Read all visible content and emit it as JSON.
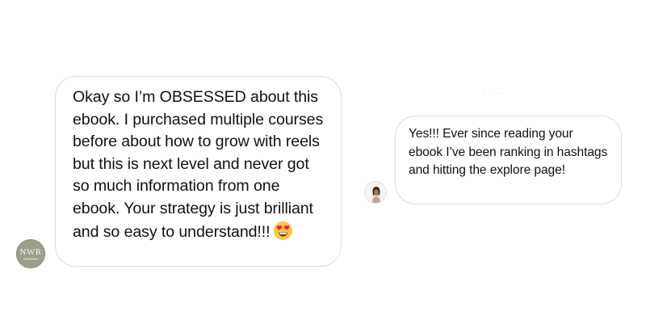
{
  "conversation": {
    "left_message": {
      "text": "Okay so I’m OBSESSED about this ebook. I purchased multiple courses before about how to grow with reels but this is next level and never got so much information from one ebook. Your strategy is just brilliant and so easy to understand!!!",
      "emoji": "heart-eyes-emoji",
      "avatar_initials": "NWR"
    },
    "right_message": {
      "text": "Yes!!! Ever since reading your ebook I’ve been ranking in hashtags and hitting the explore page!"
    }
  },
  "colors": {
    "bubble_border": "#dbdbdb",
    "avatar_left_bg": "#9ba08b",
    "emoji_face": "#ffc83d",
    "emoji_heart": "#e0245e"
  }
}
